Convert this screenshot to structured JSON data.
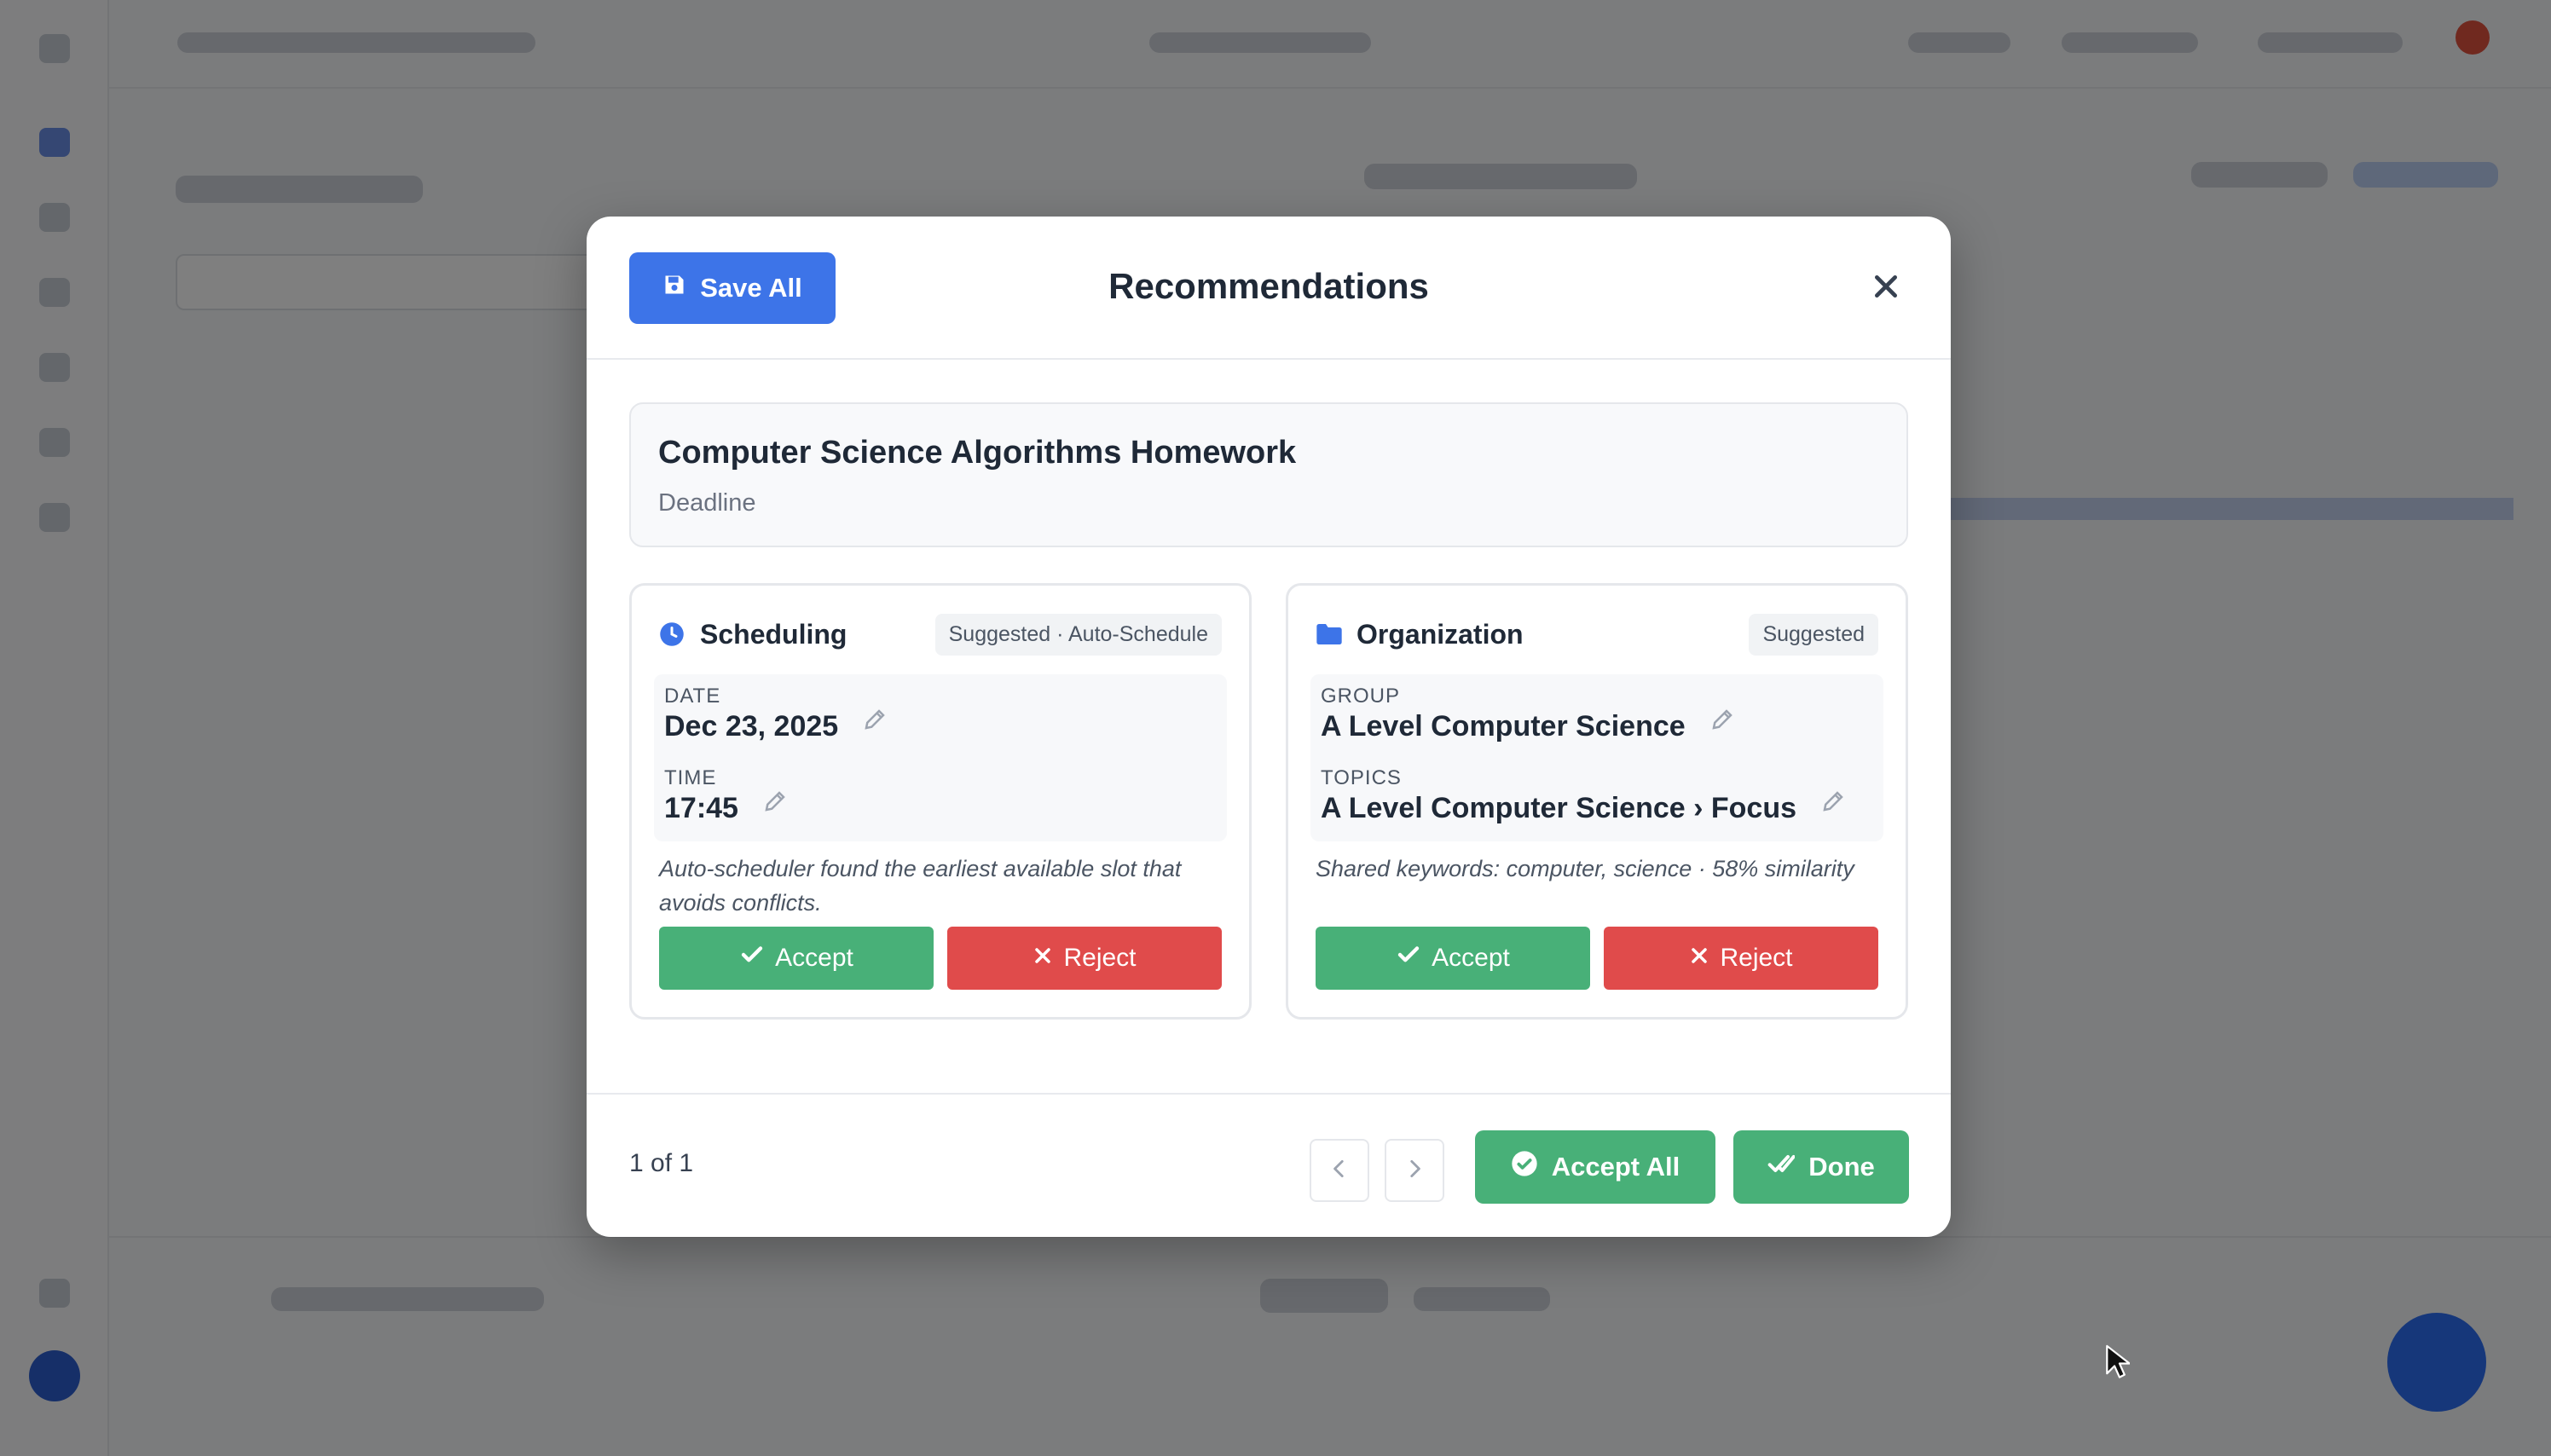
{
  "modal": {
    "save_all_label": "Save All",
    "title": "Recommendations",
    "task": {
      "title": "Computer Science Algorithms Homework",
      "subtitle": "Deadline"
    },
    "scheduling": {
      "name": "Scheduling",
      "badge": "Suggested · Auto-Schedule",
      "date_label": "DATE",
      "date_value": "Dec 23, 2025",
      "time_label": "TIME",
      "time_value": "17:45",
      "note": "Auto-scheduler found the earliest available slot that avoids conflicts.",
      "accept_label": "Accept",
      "reject_label": "Reject"
    },
    "organization": {
      "name": "Organization",
      "badge": "Suggested",
      "group_label": "GROUP",
      "group_value": "A Level Computer Science",
      "topics_label": "TOPICS",
      "topics_value": "A Level Computer Science › Focus",
      "note": "Shared keywords: computer, science · 58% similarity",
      "accept_label": "Accept",
      "reject_label": "Reject"
    },
    "footer": {
      "pager": "1 of 1",
      "accept_all_label": "Accept All",
      "done_label": "Done"
    }
  },
  "colors": {
    "primary": "#3d74e8",
    "success": "#48b078",
    "danger": "#e04b4b",
    "overlay": "rgba(0,0,0,0.5)"
  },
  "icons": {
    "save": "save-icon",
    "close": "close-icon",
    "scheduling": "clock-icon",
    "organization": "folder-icon",
    "edit": "pencil-icon",
    "accept": "check-icon",
    "reject": "x-icon",
    "prev": "chevron-left-icon",
    "next": "chevron-right-icon",
    "accept_all": "check-circle-icon",
    "done": "double-check-icon"
  }
}
